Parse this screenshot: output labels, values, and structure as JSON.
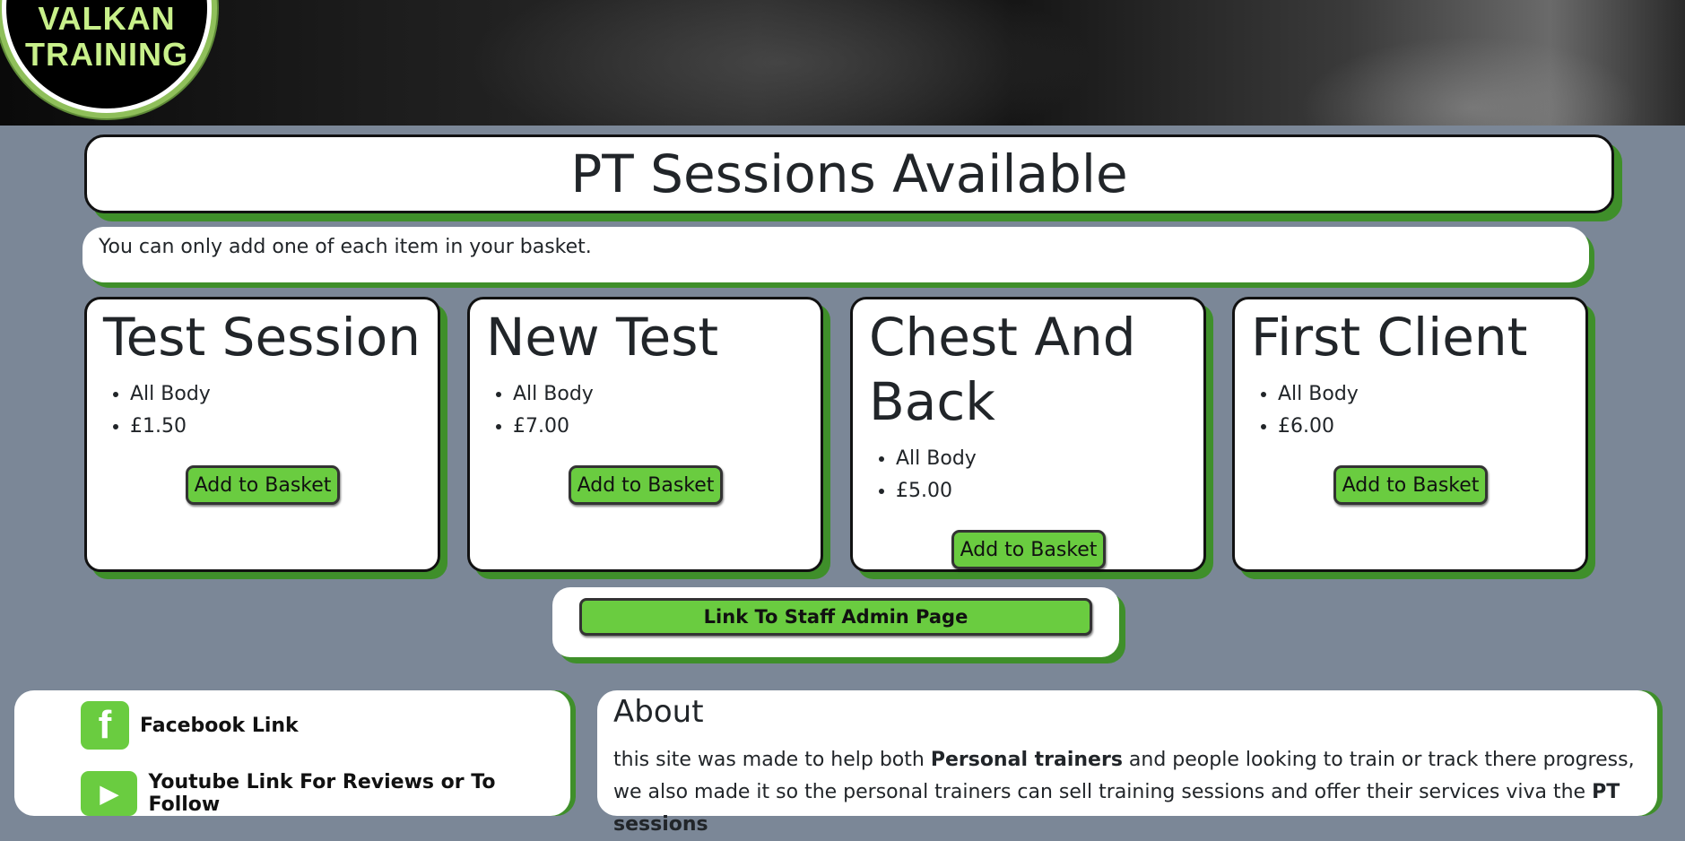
{
  "logo": {
    "line1": "VALKAN",
    "line2": "TRAINING"
  },
  "page_title": "PT Sessions Available",
  "basket_note": "You can only add one of each item in your basket.",
  "sessions": [
    {
      "name": "Test Session",
      "focus": "All Body",
      "price": "£1.50",
      "button": "Add to Basket"
    },
    {
      "name": "New Test",
      "focus": "All Body",
      "price": "£7.00",
      "button": "Add to Basket"
    },
    {
      "name": "Chest And Back",
      "focus": "All Body",
      "price": "£5.00",
      "button": "Add to Basket"
    },
    {
      "name": "First Client",
      "focus": "All Body",
      "price": "£6.00",
      "button": "Add to Basket"
    }
  ],
  "admin_link": "Link To Staff Admin Page",
  "social": {
    "facebook_label": "Facebook Link",
    "youtube_label": "Youtube Link For Reviews or To Follow"
  },
  "about": {
    "heading": "About",
    "text_1": "this site was made to help both ",
    "bold_1": "Personal trainers",
    "text_2": " and people looking to train or track there progress, we also made it so the personal trainers can sell training sessions and offer their services viva the ",
    "bold_2": "PT sessions"
  },
  "colors": {
    "accent_green": "#6acc40",
    "shadow_green": "#3f8f2a",
    "background": "#7b8797"
  }
}
